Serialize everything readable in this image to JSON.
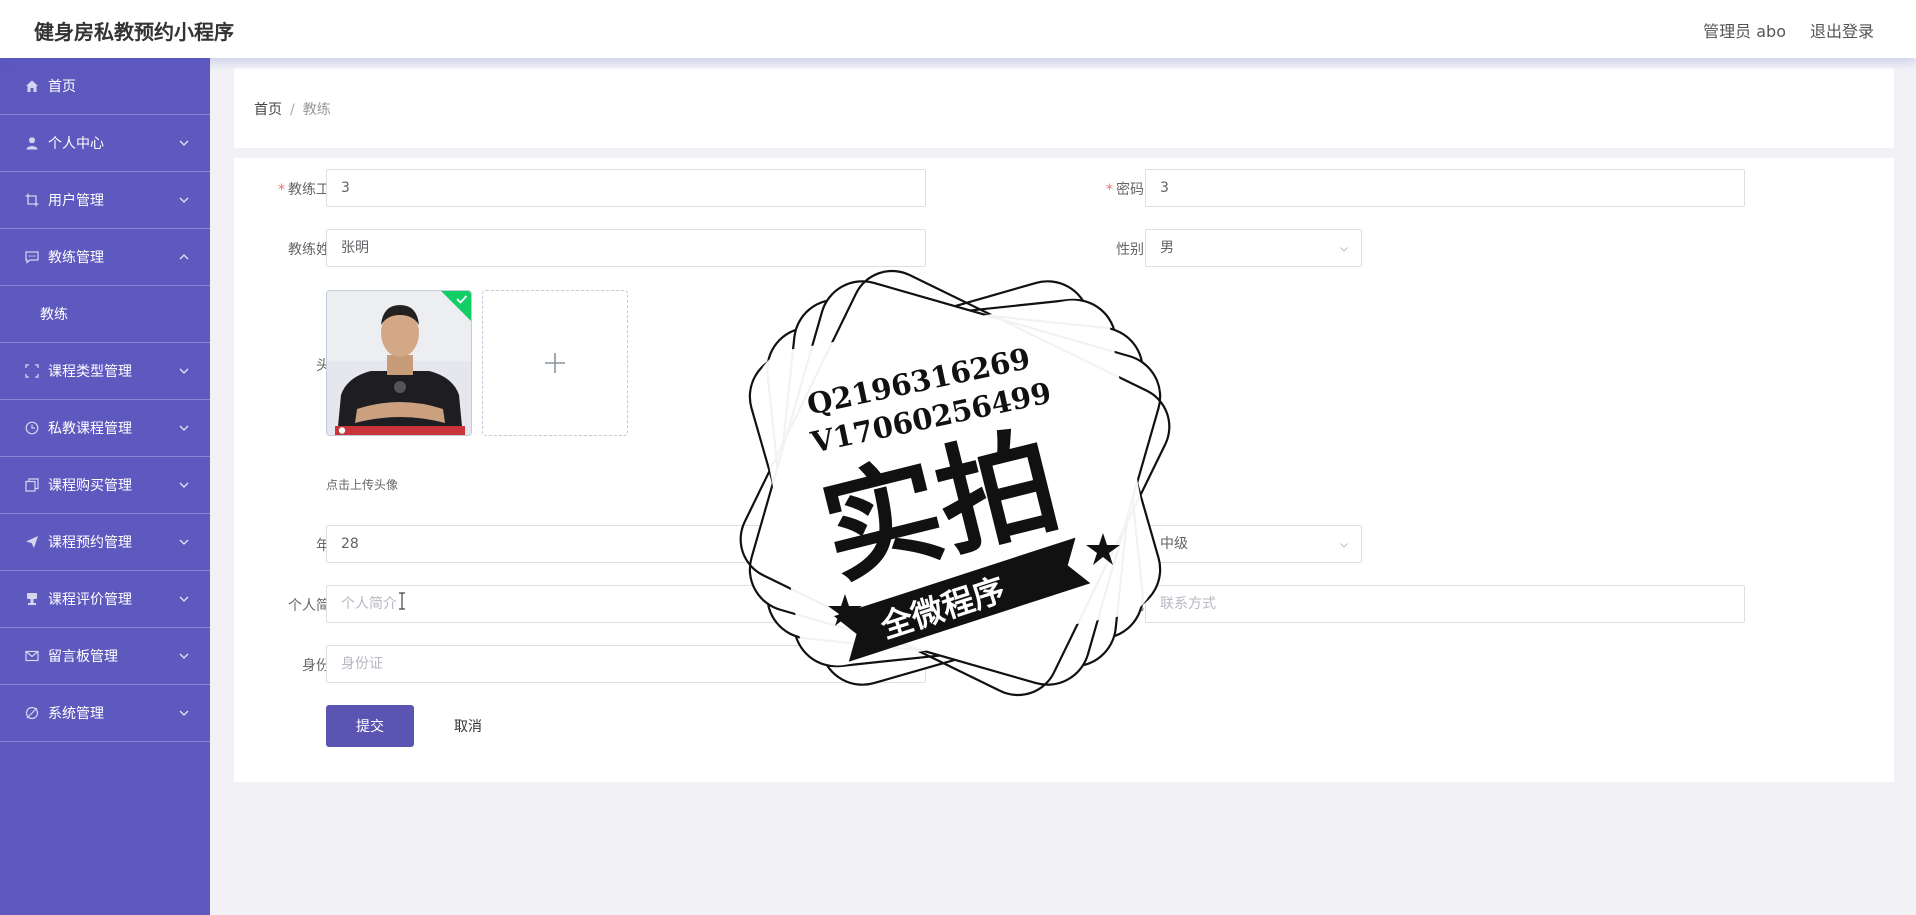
{
  "header": {
    "app_title": "健身房私教预约小程序",
    "user_label": "管理员 abo",
    "logout_label": "退出登录"
  },
  "sidebar": {
    "items": [
      {
        "label": "首页",
        "icon": "home-icon"
      },
      {
        "label": "个人中心",
        "icon": "user-icon"
      },
      {
        "label": "用户管理",
        "icon": "crop-icon"
      },
      {
        "label": "教练管理",
        "icon": "chat-icon",
        "expanded": true
      },
      {
        "label": "教练",
        "sub": true
      },
      {
        "label": "课程类型管理",
        "icon": "fullscreen-icon"
      },
      {
        "label": "私教课程管理",
        "icon": "clock-icon"
      },
      {
        "label": "课程购买管理",
        "icon": "copy-icon"
      },
      {
        "label": "课程预约管理",
        "icon": "send-icon"
      },
      {
        "label": "课程评价管理",
        "icon": "stamp-icon"
      },
      {
        "label": "留言板管理",
        "icon": "mail-icon"
      },
      {
        "label": "系统管理",
        "icon": "settings-icon"
      }
    ]
  },
  "breadcrumb": {
    "home": "首页",
    "separator": "/",
    "current": "教练"
  },
  "form": {
    "coach_no_label": "教练工号",
    "coach_no_value": "3",
    "password_label": "密码",
    "password_value": "3",
    "coach_name_label": "教练姓名",
    "coach_name_value": "张明",
    "gender_label": "性别",
    "gender_value": "男",
    "avatar_label": "头像",
    "upload_hint": "点击上传头像",
    "age_label": "年龄",
    "age_value": "28",
    "level_value": "中级",
    "intro_label": "个人简介",
    "intro_placeholder": "个人简介",
    "contact_label": "联系方式",
    "contact_placeholder": "联系方式",
    "idcard_label": "身份证",
    "idcard_placeholder": "身份证",
    "submit_label": "提交",
    "cancel_label": "取消"
  },
  "watermark": {
    "line1": "Q2196316269",
    "line2": "V17060256499",
    "main": "实拍",
    "banner": "全微程序"
  },
  "colors": {
    "sidebar": "#5e59bf",
    "primary_button": "#5a55b3",
    "required": "#f56c6c"
  }
}
